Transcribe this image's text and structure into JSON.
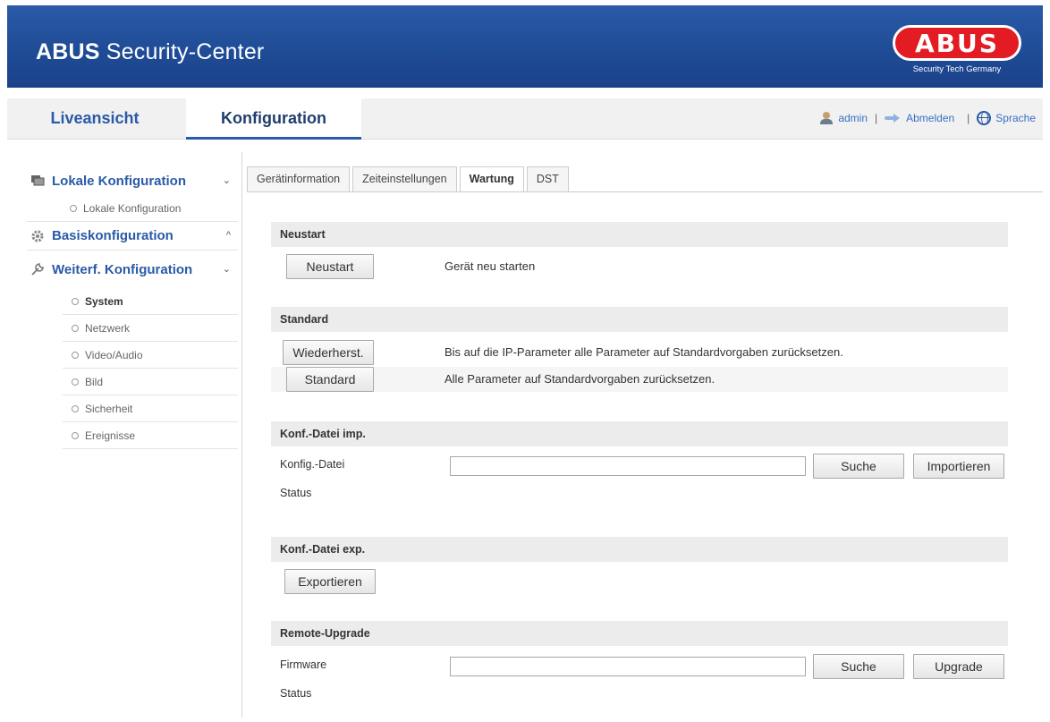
{
  "header": {
    "title_bold": "ABUS",
    "title_rest": " Security-Center",
    "logo_text": "ABUS",
    "logo_sub": "Security Tech Germany"
  },
  "nav": {
    "tabs": [
      {
        "label": "Liveansicht",
        "active": false
      },
      {
        "label": "Konfiguration",
        "active": true
      }
    ],
    "user": "admin",
    "logout": "Abmelden",
    "language": "Sprache",
    "separator": "|"
  },
  "sidebar": {
    "groups": [
      {
        "label": "Lokale Konfiguration",
        "chevron": "⌄",
        "icon": "monitor-icon"
      },
      {
        "label": "Basiskonfiguration",
        "chevron": "^",
        "icon": "gear-icon"
      },
      {
        "label": "Weiterf. Konfiguration",
        "chevron": "⌄",
        "icon": "wrench-icon"
      }
    ],
    "local_items": [
      "Lokale Konfiguration"
    ],
    "advanced_items": [
      {
        "label": "System",
        "active": true
      },
      {
        "label": "Netzwerk",
        "active": false
      },
      {
        "label": "Video/Audio",
        "active": false
      },
      {
        "label": "Bild",
        "active": false
      },
      {
        "label": "Sicherheit",
        "active": false
      },
      {
        "label": "Ereignisse",
        "active": false
      }
    ]
  },
  "tabs": [
    {
      "label": "Gerätinformation",
      "active": false
    },
    {
      "label": "Zeiteinstellungen",
      "active": false
    },
    {
      "label": "Wartung",
      "active": true
    },
    {
      "label": "DST",
      "active": false
    }
  ],
  "sections": {
    "restart": {
      "title": "Neustart",
      "button": "Neustart",
      "description": "Gerät neu starten"
    },
    "default": {
      "title": "Standard",
      "restore_button": "Wiederherst.",
      "restore_description": "Bis auf die IP-Parameter alle Parameter auf Standardvorgaben zurücksetzen.",
      "default_button": "Standard",
      "default_description": "Alle Parameter auf Standardvorgaben zurücksetzen."
    },
    "import": {
      "title": "Konf.-Datei imp.",
      "file_label": "Konfig.-Datei",
      "file_value": "",
      "search_button": "Suche",
      "import_button": "Importieren",
      "status_label": "Status"
    },
    "export": {
      "title": "Konf.-Datei exp.",
      "export_button": "Exportieren"
    },
    "upgrade": {
      "title": "Remote-Upgrade",
      "firmware_label": "Firmware",
      "firmware_value": "",
      "search_button": "Suche",
      "upgrade_button": "Upgrade",
      "status_label": "Status"
    }
  }
}
